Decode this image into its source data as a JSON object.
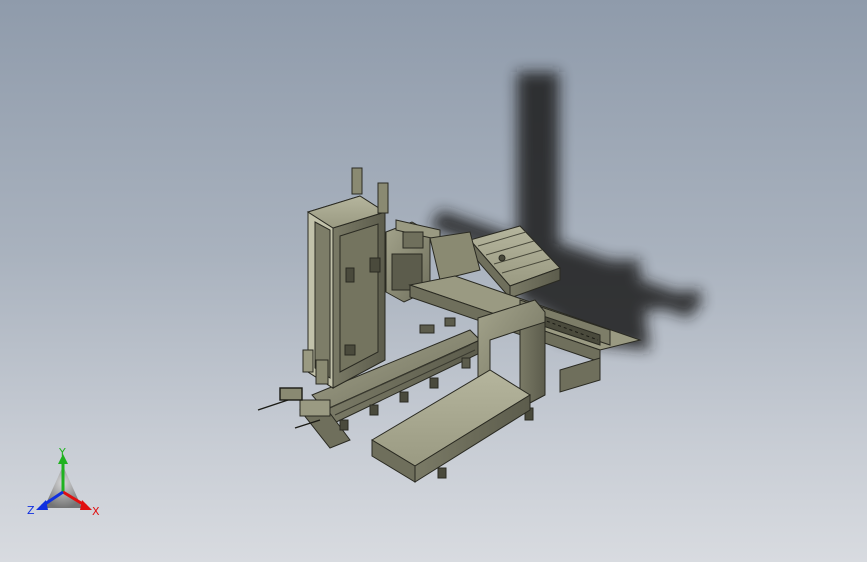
{
  "viewport": {
    "background_top": "#8f9bab",
    "background_bottom": "#d8dbe0"
  },
  "model": {
    "body_color": "#8a8a72",
    "shadow_color": "#1e1e1e",
    "edge_color": "#2a2a22"
  },
  "triad": {
    "x_label": "X",
    "y_label": "Y",
    "z_label": "Z",
    "x_color": "#e01010",
    "y_color": "#1fb21f",
    "z_color": "#1030e0"
  }
}
